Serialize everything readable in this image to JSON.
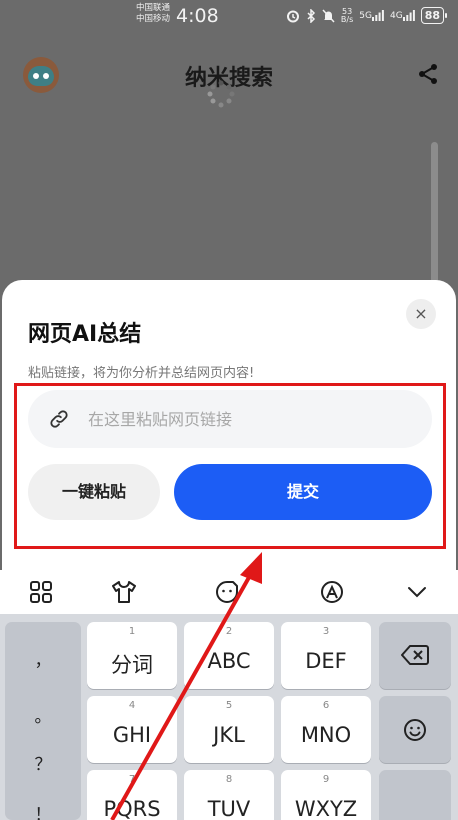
{
  "status_bar": {
    "carrier_1": "中国联通",
    "carrier_2": "中国移动",
    "time": "4:08",
    "speed_value": "53",
    "speed_unit": "B/s",
    "net_1": "5G",
    "net_2": "4G",
    "battery": "88"
  },
  "app_bar": {
    "title": "纳米搜索"
  },
  "sheet": {
    "title": "网页AI总结",
    "subtitle": "粘贴链接，将为你分析并总结网页内容!",
    "close_label": "×",
    "url_placeholder": "在这里粘贴网页链接",
    "url_value": "",
    "paste_label": "一键粘贴",
    "submit_label": "提交",
    "accent_color": "#1c5df5"
  },
  "annotation": {
    "box_color": "#e01818",
    "arrow_color": "#e01818"
  },
  "keyboard_toolbar": {
    "icons": [
      "grid-icon",
      "tshirt-icon",
      "sticker-icon",
      "handwriting-icon",
      "collapse-chevron-icon"
    ]
  },
  "keyboard": {
    "punctuation": [
      "，",
      "。",
      "？",
      "！"
    ],
    "keys": [
      {
        "num": "1",
        "label": "分词"
      },
      {
        "num": "2",
        "label": "ABC"
      },
      {
        "num": "3",
        "label": "DEF"
      },
      {
        "num": "4",
        "label": "GHI"
      },
      {
        "num": "5",
        "label": "JKL"
      },
      {
        "num": "6",
        "label": "MNO"
      },
      {
        "num": "7",
        "label": "PQRS"
      },
      {
        "num": "8",
        "label": "TUV"
      },
      {
        "num": "9",
        "label": "WXYZ"
      }
    ]
  }
}
